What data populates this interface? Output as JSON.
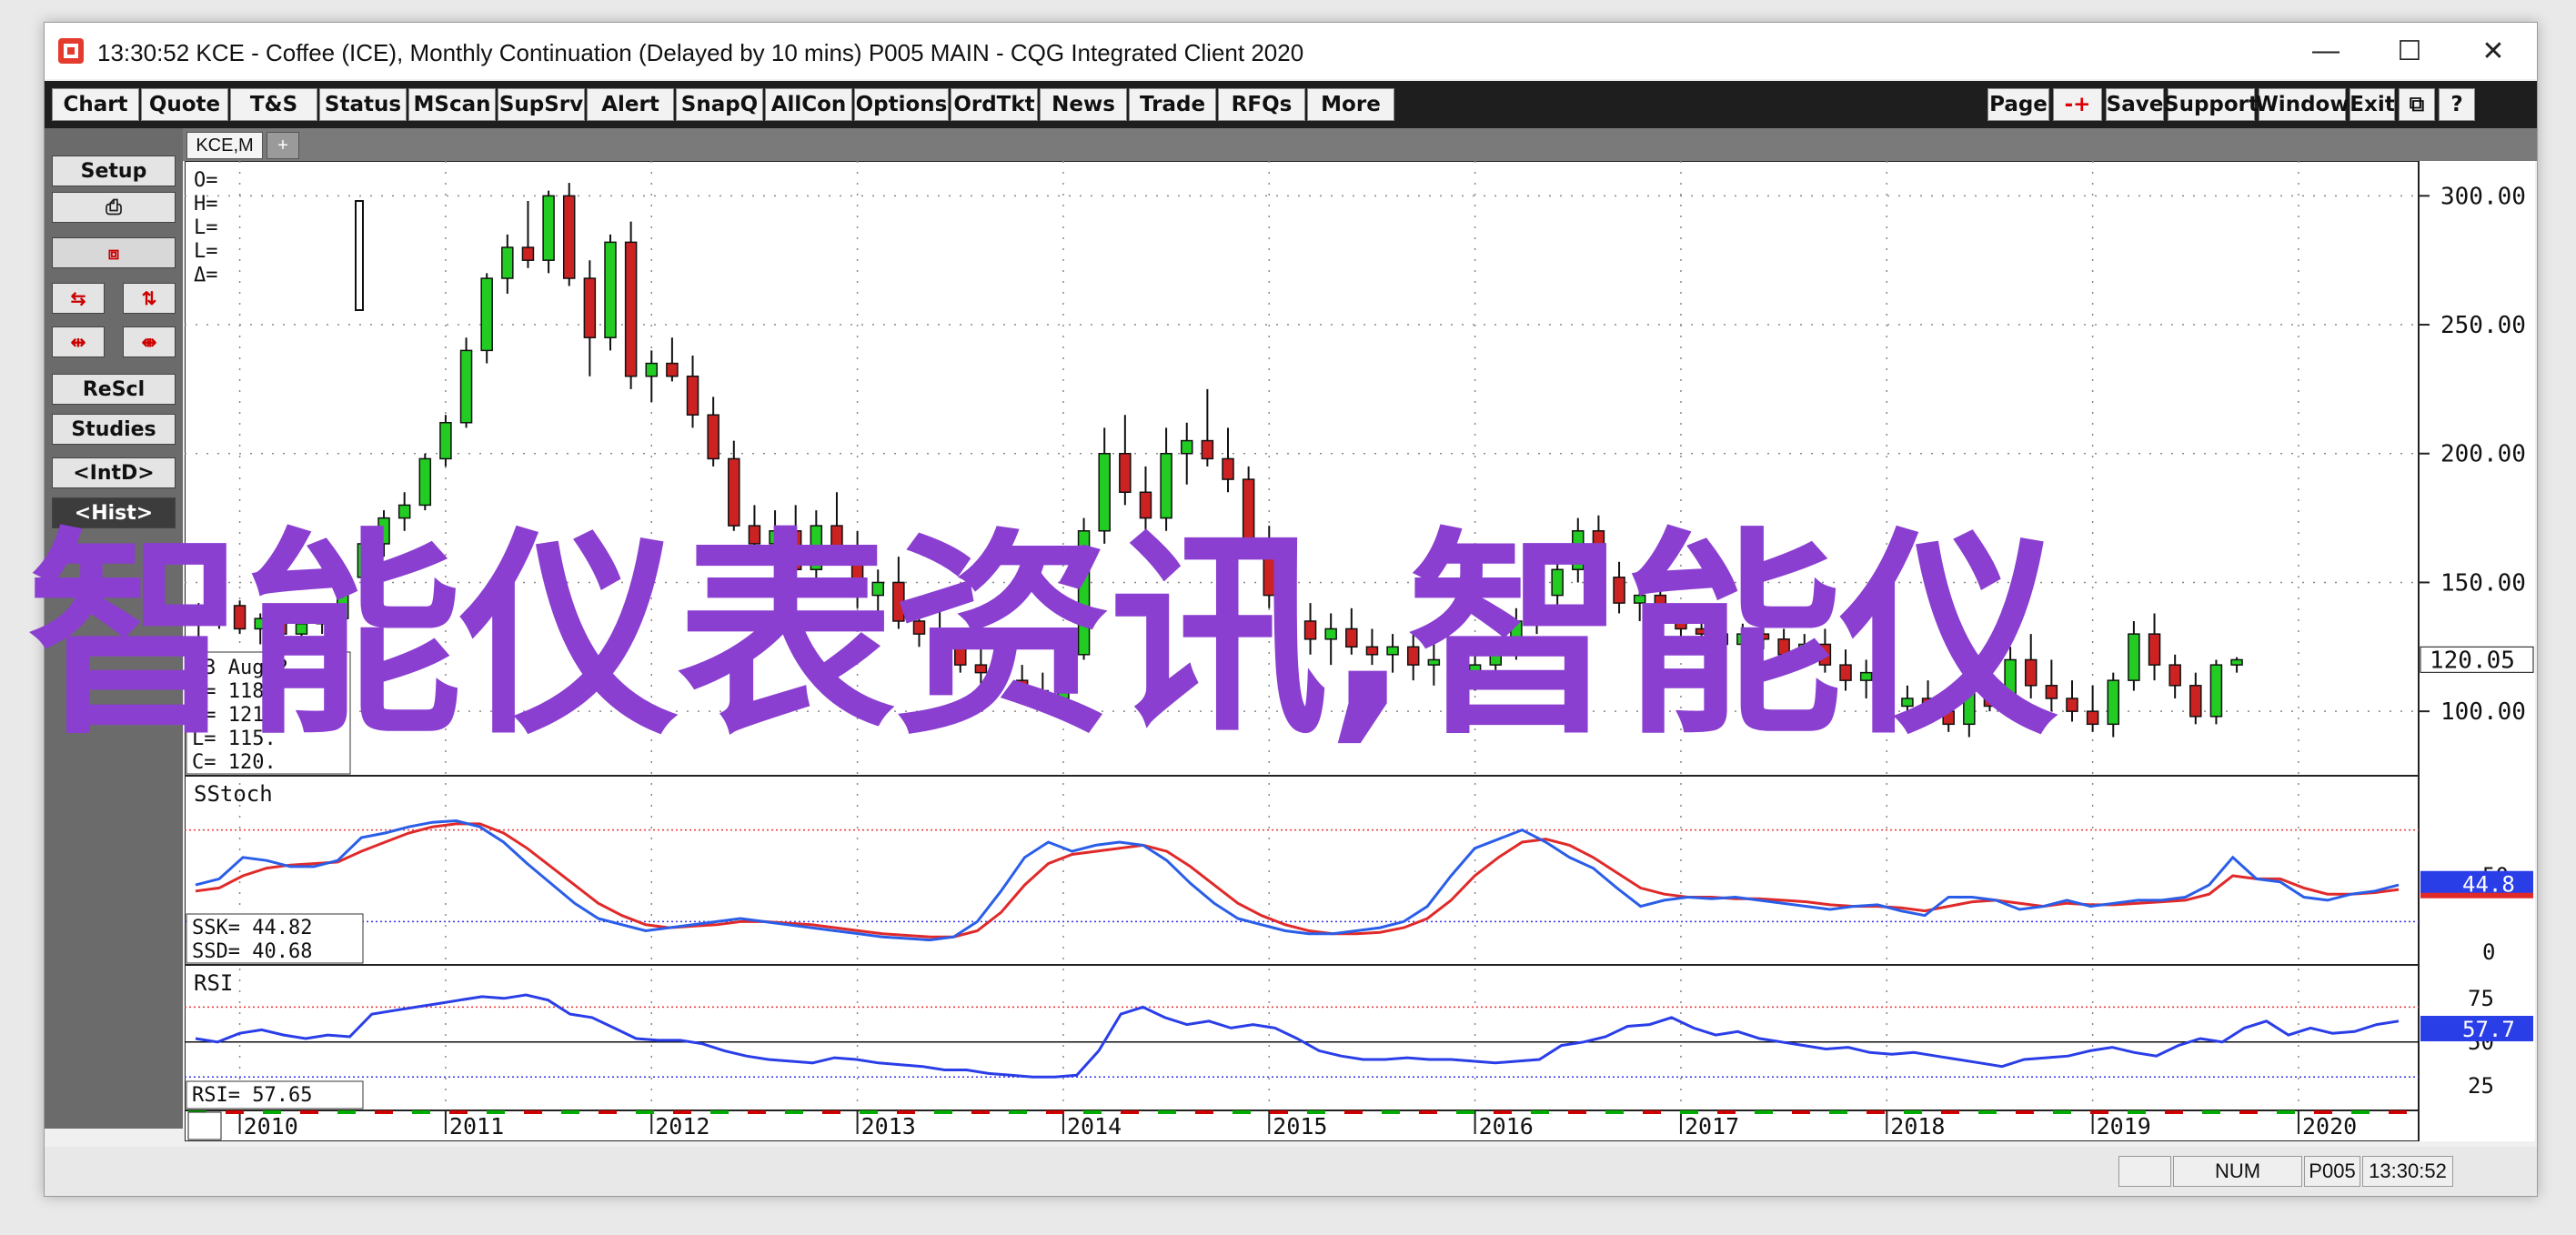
{
  "window": {
    "title": "13:30:52   KCE - Coffee (ICE), Monthly Continuation (Delayed by 10 mins)   P005 MAIN - CQG Integrated Client 2020",
    "minimize_glyph": "—",
    "maximize_glyph": "☐",
    "close_glyph": "✕"
  },
  "menubar": {
    "left": [
      "Chart",
      "Quote",
      "T&S",
      "Status",
      "MScan",
      "SupSrv",
      "Alert",
      "SnapQ",
      "AllCon",
      "Options",
      "OrdTkt",
      "News",
      "Trade",
      "RFQs",
      "More"
    ],
    "right": [
      "Page",
      "-+",
      "Save",
      "Support",
      "Window",
      "Exit",
      "⧉",
      "?"
    ]
  },
  "sidebar": {
    "setup": "Setup",
    "print_icon": "printer-icon",
    "icon_row1": [
      "arrows-left-icon",
      "arrows-swap-icon"
    ],
    "icon_row2": [
      "arrows-expand-icon",
      "arrows-compress-icon"
    ],
    "rescl": "ReScl",
    "studies": "Studies",
    "intd": "<IntD>",
    "hist": "<Hist>"
  },
  "tabs": {
    "active": "KCE,M",
    "add": "+"
  },
  "price_panel": {
    "ohlc_header": [
      "O=",
      "H=",
      "L=",
      "L=",
      "Δ="
    ],
    "price_labels": [
      "300.00",
      "250.00",
      "200.00",
      "150.00",
      "100.00"
    ],
    "current_price": "120.05",
    "last_bar": {
      "date": "03 Aug 2",
      "open": "118.",
      "high": "121.",
      "low": "115.",
      "close": "120."
    }
  },
  "stoch_panel": {
    "title": "SStoch",
    "ssk_label": "SSK=",
    "ssk_value": "44.82",
    "ssd_label": "SSD=",
    "ssd_value": "40.68",
    "axis_labels": [
      "50",
      "0"
    ],
    "current": "44.8"
  },
  "rsi_panel": {
    "title": "RSI",
    "rsi_label": "RSI=",
    "rsi_value": "57.65",
    "axis_labels": [
      "75",
      "50",
      "25"
    ],
    "current": "57.7"
  },
  "time_axis": {
    "years": [
      "2010",
      "2011",
      "2012",
      "2013",
      "2014",
      "2015",
      "2016",
      "2017",
      "2018",
      "2019",
      "2020"
    ]
  },
  "statusbar": {
    "num": "NUM",
    "page": "P005",
    "time": "13:30:52"
  },
  "watermark": "智能仪表资讯,智能仪",
  "colors": {
    "up": "#22cc22",
    "down": "#cc2222",
    "ssk": "#2a5ee8",
    "ssd": "#e02a2a",
    "rsi": "#2a3ee8"
  },
  "chart_data": {
    "type": "candlestick",
    "x_range": [
      "2009-10",
      "2020-08"
    ],
    "ylim": [
      75,
      310
    ],
    "candles_monthly_sampled": [
      [
        2009.8,
        135,
        142,
        128,
        138
      ],
      [
        2009.9,
        138,
        145,
        132,
        141
      ],
      [
        2010.0,
        141,
        143,
        130,
        132
      ],
      [
        2010.1,
        132,
        138,
        126,
        136
      ],
      [
        2010.2,
        136,
        140,
        128,
        130
      ],
      [
        2010.3,
        130,
        138,
        127,
        134
      ],
      [
        2010.4,
        134,
        140,
        130,
        136
      ],
      [
        2010.5,
        136,
        155,
        134,
        152
      ],
      [
        2010.6,
        152,
        168,
        150,
        165
      ],
      [
        2010.7,
        165,
        178,
        160,
        175
      ],
      [
        2010.8,
        175,
        185,
        170,
        180
      ],
      [
        2010.9,
        180,
        200,
        178,
        198
      ],
      [
        2011.0,
        198,
        215,
        195,
        212
      ],
      [
        2011.1,
        212,
        245,
        210,
        240
      ],
      [
        2011.2,
        240,
        270,
        235,
        268
      ],
      [
        2011.3,
        268,
        285,
        262,
        280
      ],
      [
        2011.4,
        280,
        298,
        272,
        275
      ],
      [
        2011.5,
        275,
        302,
        270,
        300
      ],
      [
        2011.6,
        300,
        305,
        265,
        268
      ],
      [
        2011.7,
        268,
        275,
        230,
        245
      ],
      [
        2011.8,
        245,
        285,
        240,
        282
      ],
      [
        2011.9,
        282,
        290,
        225,
        230
      ],
      [
        2012.0,
        230,
        240,
        220,
        235
      ],
      [
        2012.1,
        235,
        245,
        228,
        230
      ],
      [
        2012.2,
        230,
        238,
        210,
        215
      ],
      [
        2012.3,
        215,
        222,
        195,
        198
      ],
      [
        2012.4,
        198,
        205,
        170,
        172
      ],
      [
        2012.5,
        172,
        180,
        160,
        165
      ],
      [
        2012.6,
        165,
        178,
        155,
        170
      ],
      [
        2012.7,
        170,
        180,
        150,
        155
      ],
      [
        2012.8,
        155,
        178,
        150,
        172
      ],
      [
        2012.9,
        172,
        185,
        160,
        162
      ],
      [
        2013.0,
        162,
        170,
        140,
        145
      ],
      [
        2013.1,
        145,
        155,
        138,
        150
      ],
      [
        2013.2,
        150,
        160,
        132,
        135
      ],
      [
        2013.3,
        135,
        142,
        125,
        130
      ],
      [
        2013.4,
        130,
        140,
        120,
        125
      ],
      [
        2013.5,
        125,
        132,
        115,
        118
      ],
      [
        2013.6,
        118,
        125,
        110,
        115
      ],
      [
        2013.7,
        115,
        122,
        108,
        112
      ],
      [
        2013.8,
        112,
        118,
        105,
        108
      ],
      [
        2013.9,
        108,
        115,
        100,
        105
      ],
      [
        2014.0,
        105,
        125,
        102,
        122
      ],
      [
        2014.1,
        122,
        175,
        120,
        170
      ],
      [
        2014.2,
        170,
        210,
        165,
        200
      ],
      [
        2014.3,
        200,
        215,
        180,
        185
      ],
      [
        2014.4,
        185,
        195,
        165,
        175
      ],
      [
        2014.5,
        175,
        210,
        170,
        200
      ],
      [
        2014.6,
        200,
        212,
        188,
        205
      ],
      [
        2014.7,
        205,
        225,
        195,
        198
      ],
      [
        2014.8,
        198,
        210,
        185,
        190
      ],
      [
        2014.9,
        190,
        195,
        160,
        165
      ],
      [
        2015.0,
        165,
        172,
        140,
        145
      ],
      [
        2015.1,
        145,
        150,
        128,
        135
      ],
      [
        2015.2,
        135,
        142,
        122,
        128
      ],
      [
        2015.3,
        128,
        138,
        118,
        132
      ],
      [
        2015.4,
        132,
        140,
        122,
        125
      ],
      [
        2015.5,
        125,
        132,
        118,
        122
      ],
      [
        2015.6,
        122,
        130,
        115,
        125
      ],
      [
        2015.7,
        125,
        130,
        112,
        118
      ],
      [
        2015.8,
        118,
        126,
        110,
        120
      ],
      [
        2015.9,
        120,
        128,
        112,
        115
      ],
      [
        2016.0,
        115,
        122,
        108,
        118
      ],
      [
        2016.1,
        118,
        128,
        115,
        125
      ],
      [
        2016.2,
        125,
        140,
        120,
        135
      ],
      [
        2016.3,
        135,
        150,
        130,
        145
      ],
      [
        2016.4,
        145,
        160,
        140,
        155
      ],
      [
        2016.5,
        155,
        175,
        150,
        170
      ],
      [
        2016.6,
        170,
        176,
        150,
        152
      ],
      [
        2016.7,
        152,
        158,
        138,
        142
      ],
      [
        2016.8,
        142,
        150,
        135,
        145
      ],
      [
        2016.9,
        145,
        150,
        130,
        135
      ],
      [
        2017.0,
        135,
        140,
        128,
        132
      ],
      [
        2017.1,
        132,
        138,
        125,
        130
      ],
      [
        2017.2,
        130,
        136,
        122,
        126
      ],
      [
        2017.3,
        126,
        134,
        120,
        130
      ],
      [
        2017.4,
        130,
        136,
        124,
        128
      ],
      [
        2017.5,
        128,
        132,
        118,
        122
      ],
      [
        2017.6,
        122,
        130,
        118,
        126
      ],
      [
        2017.7,
        126,
        132,
        115,
        118
      ],
      [
        2017.8,
        118,
        124,
        108,
        112
      ],
      [
        2017.9,
        112,
        120,
        105,
        115
      ],
      [
        2018.0,
        115,
        120,
        100,
        102
      ],
      [
        2018.1,
        102,
        110,
        95,
        105
      ],
      [
        2018.2,
        105,
        112,
        98,
        100
      ],
      [
        2018.3,
        100,
        105,
        92,
        95
      ],
      [
        2018.4,
        95,
        110,
        90,
        108
      ],
      [
        2018.5,
        108,
        115,
        100,
        102
      ],
      [
        2018.6,
        102,
        125,
        98,
        120
      ],
      [
        2018.7,
        120,
        130,
        105,
        110
      ],
      [
        2018.8,
        110,
        120,
        100,
        105
      ],
      [
        2018.9,
        105,
        112,
        96,
        100
      ],
      [
        2019.0,
        100,
        110,
        92,
        95
      ],
      [
        2019.1,
        95,
        115,
        90,
        112
      ],
      [
        2019.2,
        112,
        135,
        108,
        130
      ],
      [
        2019.3,
        130,
        138,
        112,
        118
      ],
      [
        2019.4,
        118,
        122,
        105,
        110
      ],
      [
        2019.5,
        110,
        115,
        95,
        98
      ],
      [
        2019.6,
        98,
        120,
        95,
        118
      ],
      [
        2019.7,
        118,
        121,
        115,
        120
      ]
    ]
  }
}
